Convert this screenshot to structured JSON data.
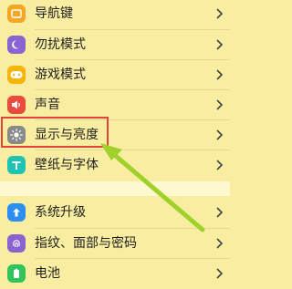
{
  "settings": {
    "items": [
      {
        "label": "导航键",
        "icon": "navigation-keys-icon",
        "color": "#f5a623"
      },
      {
        "label": "勿扰模式",
        "icon": "moon-icon",
        "color": "#8a63d2"
      },
      {
        "label": "游戏模式",
        "icon": "gamepad-icon",
        "color": "#f5b50a"
      },
      {
        "label": "声音",
        "icon": "speaker-icon",
        "color": "#ea4b3c"
      },
      {
        "label": "显示与亮度",
        "icon": "sun-icon",
        "color": "#8a8a8a"
      },
      {
        "label": "壁纸与字体",
        "icon": "text-t-icon",
        "color": "#1fc3b4"
      },
      {
        "label": "系统升级",
        "icon": "update-icon",
        "color": "#2b8ff2"
      },
      {
        "label": "指纹、面部与密码",
        "icon": "fingerprint-icon",
        "color": "#8a63d2"
      },
      {
        "label": "电池",
        "icon": "battery-icon",
        "color": "#31c45a"
      }
    ]
  },
  "annotation": {
    "highlight_color": "#e2443c",
    "arrow_color": "#9fd12a"
  }
}
